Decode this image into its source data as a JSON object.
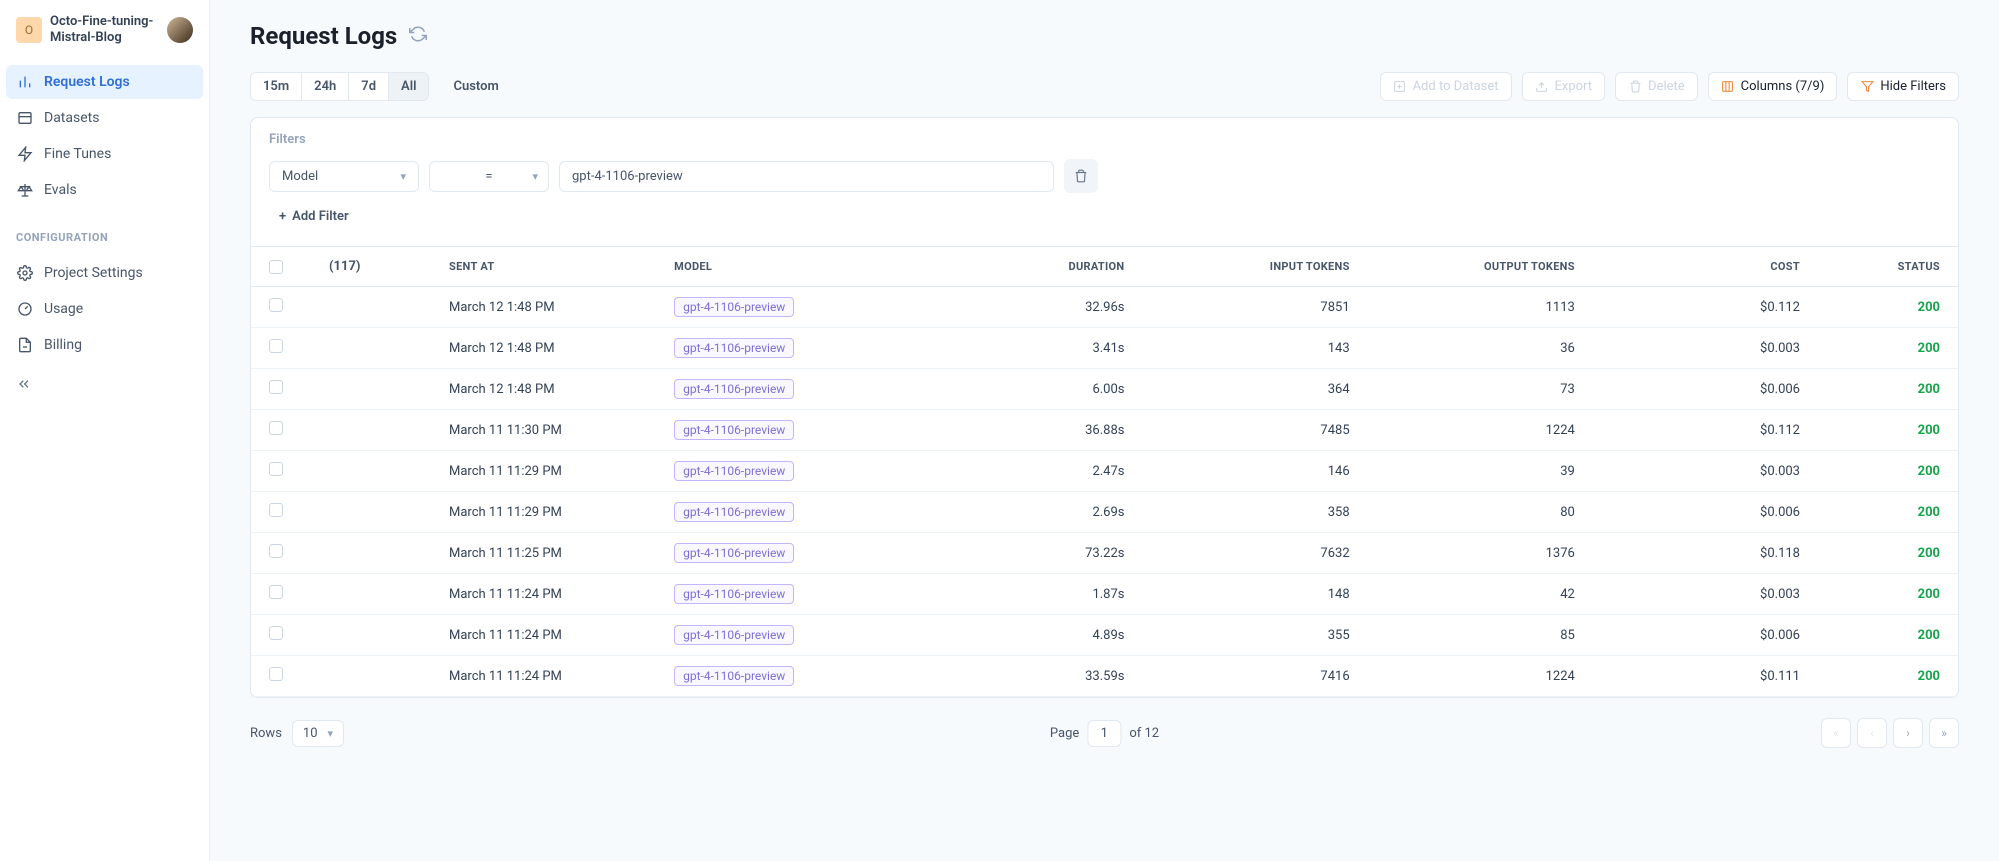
{
  "project": {
    "avatar_letter": "O",
    "name": "Octo-Fine-tuning-Mistral-Blog"
  },
  "sidebar": {
    "items": [
      {
        "label": "Request Logs",
        "icon": "bars-icon",
        "active": true
      },
      {
        "label": "Datasets",
        "icon": "dataset-icon",
        "active": false
      },
      {
        "label": "Fine Tunes",
        "icon": "bolt-icon",
        "active": false
      },
      {
        "label": "Evals",
        "icon": "scale-icon",
        "active": false
      }
    ],
    "section_label": "CONFIGURATION",
    "config_items": [
      {
        "label": "Project Settings",
        "icon": "gear-icon"
      },
      {
        "label": "Usage",
        "icon": "gauge-icon"
      },
      {
        "label": "Billing",
        "icon": "billing-icon"
      }
    ]
  },
  "page": {
    "title": "Request Logs"
  },
  "time_range": {
    "options": [
      "15m",
      "24h",
      "7d",
      "All"
    ],
    "active": "All",
    "custom_label": "Custom"
  },
  "toolbar": {
    "add_to_dataset": "Add to Dataset",
    "export": "Export",
    "delete": "Delete",
    "columns": "Columns (7/9)",
    "hide_filters": "Hide Filters"
  },
  "filters": {
    "label": "Filters",
    "rows": [
      {
        "field": "Model",
        "op": "=",
        "value": "gpt-4-1106-preview"
      }
    ],
    "add_label": "Add Filter"
  },
  "table": {
    "count_label": "(117)",
    "columns": [
      "SENT AT",
      "MODEL",
      "DURATION",
      "INPUT TOKENS",
      "OUTPUT TOKENS",
      "COST",
      "STATUS"
    ],
    "rows": [
      {
        "sent_at": "March 12 1:48 PM",
        "model": "gpt-4-1106-preview",
        "duration": "32.96s",
        "input": "7851",
        "output": "1113",
        "cost": "$0.112",
        "status": "200"
      },
      {
        "sent_at": "March 12 1:48 PM",
        "model": "gpt-4-1106-preview",
        "duration": "3.41s",
        "input": "143",
        "output": "36",
        "cost": "$0.003",
        "status": "200"
      },
      {
        "sent_at": "March 12 1:48 PM",
        "model": "gpt-4-1106-preview",
        "duration": "6.00s",
        "input": "364",
        "output": "73",
        "cost": "$0.006",
        "status": "200"
      },
      {
        "sent_at": "March 11 11:30 PM",
        "model": "gpt-4-1106-preview",
        "duration": "36.88s",
        "input": "7485",
        "output": "1224",
        "cost": "$0.112",
        "status": "200"
      },
      {
        "sent_at": "March 11 11:29 PM",
        "model": "gpt-4-1106-preview",
        "duration": "2.47s",
        "input": "146",
        "output": "39",
        "cost": "$0.003",
        "status": "200"
      },
      {
        "sent_at": "March 11 11:29 PM",
        "model": "gpt-4-1106-preview",
        "duration": "2.69s",
        "input": "358",
        "output": "80",
        "cost": "$0.006",
        "status": "200"
      },
      {
        "sent_at": "March 11 11:25 PM",
        "model": "gpt-4-1106-preview",
        "duration": "73.22s",
        "input": "7632",
        "output": "1376",
        "cost": "$0.118",
        "status": "200"
      },
      {
        "sent_at": "March 11 11:24 PM",
        "model": "gpt-4-1106-preview",
        "duration": "1.87s",
        "input": "148",
        "output": "42",
        "cost": "$0.003",
        "status": "200"
      },
      {
        "sent_at": "March 11 11:24 PM",
        "model": "gpt-4-1106-preview",
        "duration": "4.89s",
        "input": "355",
        "output": "85",
        "cost": "$0.006",
        "status": "200"
      },
      {
        "sent_at": "March 11 11:24 PM",
        "model": "gpt-4-1106-preview",
        "duration": "33.59s",
        "input": "7416",
        "output": "1224",
        "cost": "$0.111",
        "status": "200"
      }
    ]
  },
  "footer": {
    "rows_label": "Rows",
    "rows_value": "10",
    "page_label": "Page",
    "page_value": "1",
    "page_total": "of 12"
  }
}
